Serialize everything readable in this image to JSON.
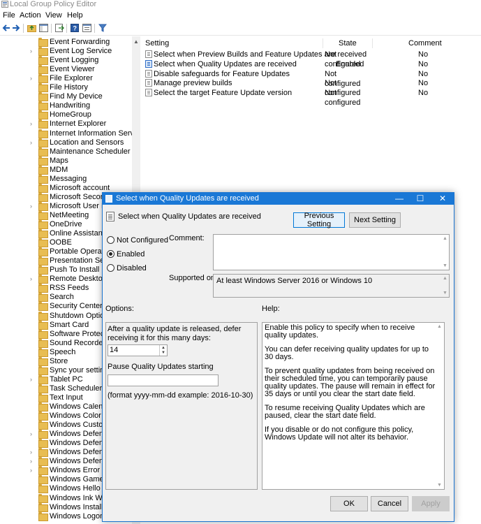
{
  "window": {
    "title": "Local Group Policy Editor"
  },
  "menu": [
    "File",
    "Action",
    "View",
    "Help"
  ],
  "tree": {
    "items": [
      {
        "label": "Event Forwarding",
        "expandable": false
      },
      {
        "label": "Event Log Service",
        "expandable": true
      },
      {
        "label": "Event Logging",
        "expandable": false
      },
      {
        "label": "Event Viewer",
        "expandable": false
      },
      {
        "label": "File Explorer",
        "expandable": true
      },
      {
        "label": "File History",
        "expandable": false
      },
      {
        "label": "Find My Device",
        "expandable": false
      },
      {
        "label": "Handwriting",
        "expandable": false
      },
      {
        "label": "HomeGroup",
        "expandable": false
      },
      {
        "label": "Internet Explorer",
        "expandable": true
      },
      {
        "label": "Internet Information Services",
        "expandable": false
      },
      {
        "label": "Location and Sensors",
        "expandable": true
      },
      {
        "label": "Maintenance Scheduler",
        "expandable": false
      },
      {
        "label": "Maps",
        "expandable": false
      },
      {
        "label": "MDM",
        "expandable": false
      },
      {
        "label": "Messaging",
        "expandable": false
      },
      {
        "label": "Microsoft account",
        "expandable": false
      },
      {
        "label": "Microsoft Secondary Authentication Factor",
        "expandable": false
      },
      {
        "label": "Microsoft User Experience Virtualization",
        "expandable": true
      },
      {
        "label": "NetMeeting",
        "expandable": false
      },
      {
        "label": "OneDrive",
        "expandable": false
      },
      {
        "label": "Online Assistance",
        "expandable": false
      },
      {
        "label": "OOBE",
        "expandable": false
      },
      {
        "label": "Portable Operating System",
        "expandable": false
      },
      {
        "label": "Presentation Settings",
        "expandable": false
      },
      {
        "label": "Push To Install",
        "expandable": false
      },
      {
        "label": "Remote Desktop Services",
        "expandable": true
      },
      {
        "label": "RSS Feeds",
        "expandable": false
      },
      {
        "label": "Search",
        "expandable": false
      },
      {
        "label": "Security Center",
        "expandable": false
      },
      {
        "label": "Shutdown Options",
        "expandable": false
      },
      {
        "label": "Smart Card",
        "expandable": false
      },
      {
        "label": "Software Protection Platform",
        "expandable": false
      },
      {
        "label": "Sound Recorder",
        "expandable": false
      },
      {
        "label": "Speech",
        "expandable": false
      },
      {
        "label": "Store",
        "expandable": false
      },
      {
        "label": "Sync your settings",
        "expandable": false
      },
      {
        "label": "Tablet PC",
        "expandable": true
      },
      {
        "label": "Task Scheduler",
        "expandable": false
      },
      {
        "label": "Text Input",
        "expandable": false
      },
      {
        "label": "Windows Calendar",
        "expandable": false
      },
      {
        "label": "Windows Color System",
        "expandable": false
      },
      {
        "label": "Windows Customer Experience Improvement Program",
        "expandable": false
      },
      {
        "label": "Windows Defender Antivirus",
        "expandable": true
      },
      {
        "label": "Windows Defender Application Guard",
        "expandable": false
      },
      {
        "label": "Windows Defender Exploit Guard",
        "expandable": true
      },
      {
        "label": "Windows Defender SmartScreen",
        "expandable": true
      },
      {
        "label": "Windows Error Reporting",
        "expandable": true
      },
      {
        "label": "Windows Game Recording and Broadcasting",
        "expandable": false
      },
      {
        "label": "Windows Hello for Business",
        "expandable": false
      },
      {
        "label": "Windows Ink Workspace",
        "expandable": false
      },
      {
        "label": "Windows Installer",
        "expandable": false
      },
      {
        "label": "Windows Logon Options",
        "expandable": false
      }
    ]
  },
  "list": {
    "headers": {
      "setting": "Setting",
      "state": "State",
      "comment": "Comment"
    },
    "rows": [
      {
        "setting": "Select when Preview Builds and Feature Updates are received",
        "state": "Not configured",
        "comment": "No",
        "selected": false
      },
      {
        "setting": "Select when Quality Updates are received",
        "state": "Enabled",
        "comment": "No",
        "selected": true
      },
      {
        "setting": "Disable safeguards for Feature Updates",
        "state": "Not configured",
        "comment": "No",
        "selected": false
      },
      {
        "setting": "Manage preview builds",
        "state": "Not configured",
        "comment": "No",
        "selected": false
      },
      {
        "setting": "Select the target Feature Update version",
        "state": "Not configured",
        "comment": "No",
        "selected": false
      }
    ]
  },
  "dialog": {
    "title": "Select when Quality Updates are received",
    "header_title": "Select when Quality Updates are received",
    "prev_button": "Previous Setting",
    "next_button": "Next Setting",
    "radios": [
      {
        "label": "Not Configured",
        "checked": false
      },
      {
        "label": "Enabled",
        "checked": true
      },
      {
        "label": "Disabled",
        "checked": false
      }
    ],
    "comment_label": "Comment:",
    "comment_value": "",
    "supported_label": "Supported on:",
    "supported_value": "At least Windows Server 2016 or Windows 10",
    "options_label": "Options:",
    "help_label": "Help:",
    "options": {
      "defer_label": "After a quality update is released, defer receiving it for this many days:",
      "defer_value": "14",
      "pause_label": "Pause Quality Updates starting",
      "pause_value": "",
      "format_hint": "(format yyyy-mm-dd example: 2016-10-30)"
    },
    "help_paragraphs": [
      "Enable this policy to specify when to receive quality updates.",
      "You can defer receiving quality updates for up to 30 days.",
      "To prevent quality updates from being received on their scheduled time, you can temporarily pause quality updates. The pause will remain in effect for 35 days or until you clear the start date field.",
      "To resume receiving Quality Updates which are paused, clear the start date field.",
      "If you disable or do not configure this policy, Windows Update will not alter its behavior."
    ],
    "ok_button": "OK",
    "cancel_button": "Cancel",
    "apply_button": "Apply"
  }
}
